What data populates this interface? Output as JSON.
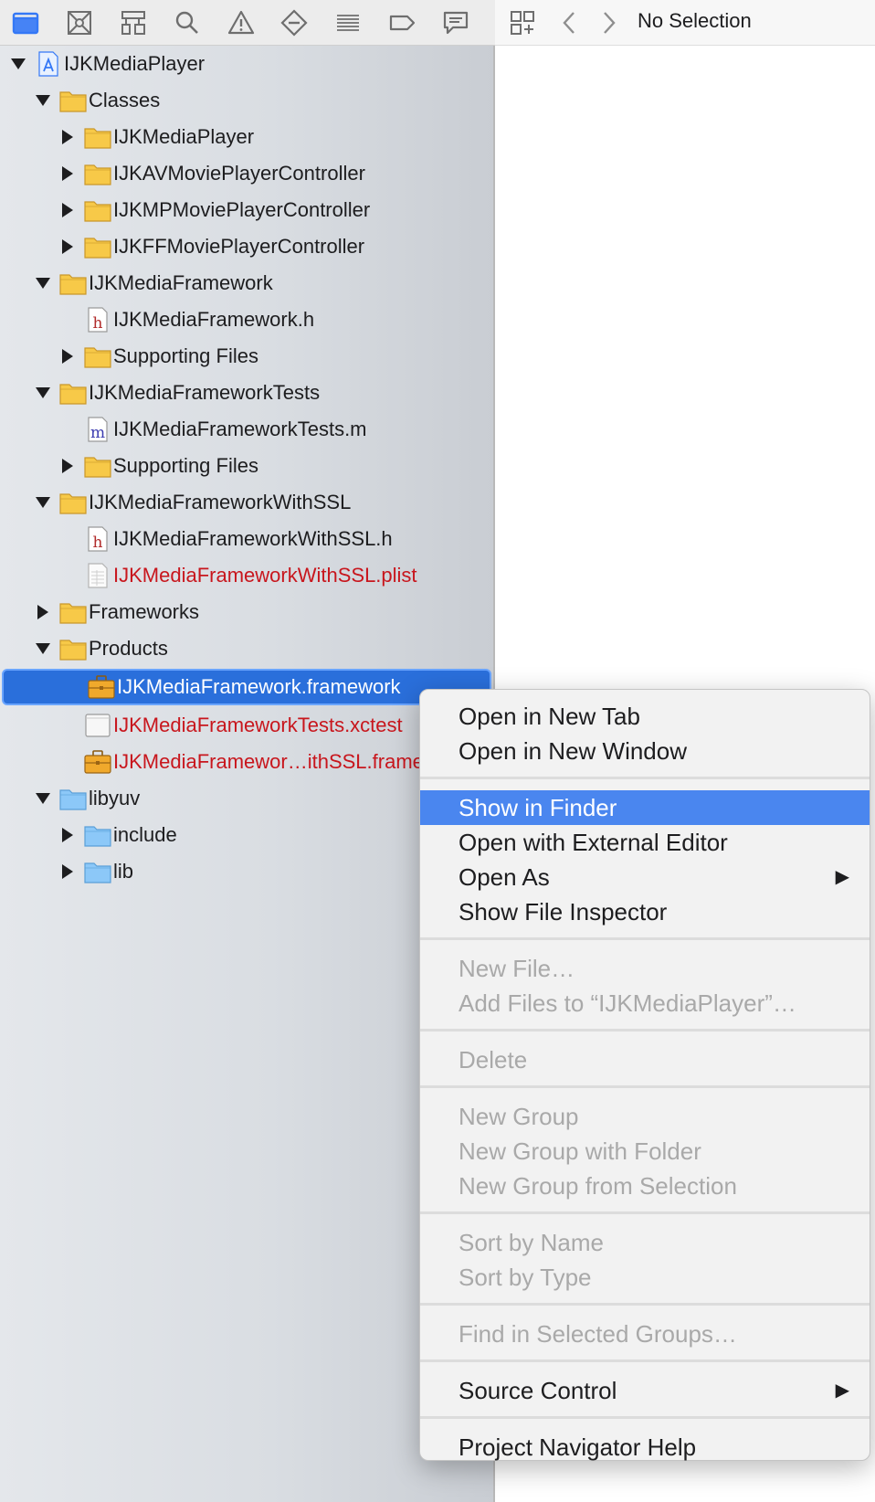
{
  "toolbar": {
    "icons": [
      "project-navigator-icon",
      "source-control-icon",
      "symbol-navigator-icon",
      "find-navigator-icon",
      "issue-navigator-icon",
      "test-navigator-icon",
      "debug-navigator-icon",
      "breakpoint-navigator-icon",
      "report-navigator-icon"
    ],
    "active_color": "#3478f6"
  },
  "jumpbar": {
    "title": "No Selection",
    "icons": [
      "related-items-icon",
      "back-chevron-icon",
      "forward-chevron-icon"
    ]
  },
  "tree": [
    {
      "label": "IJKMediaPlayer",
      "kind": "project",
      "depth": 0,
      "disclosure": "open"
    },
    {
      "label": "Classes",
      "kind": "folder",
      "depth": 1,
      "disclosure": "open"
    },
    {
      "label": "IJKMediaPlayer",
      "kind": "folder",
      "depth": 2,
      "disclosure": "closed"
    },
    {
      "label": "IJKAVMoviePlayerController",
      "kind": "folder",
      "depth": 2,
      "disclosure": "closed"
    },
    {
      "label": "IJKMPMoviePlayerController",
      "kind": "folder",
      "depth": 2,
      "disclosure": "closed"
    },
    {
      "label": "IJKFFMoviePlayerController",
      "kind": "folder",
      "depth": 2,
      "disclosure": "closed"
    },
    {
      "label": "IJKMediaFramework",
      "kind": "folder",
      "depth": 1,
      "disclosure": "open"
    },
    {
      "label": "IJKMediaFramework.h",
      "kind": "h",
      "depth": 2,
      "disclosure": "none"
    },
    {
      "label": "Supporting Files",
      "kind": "folder",
      "depth": 2,
      "disclosure": "closed"
    },
    {
      "label": "IJKMediaFrameworkTests",
      "kind": "folder",
      "depth": 1,
      "disclosure": "open"
    },
    {
      "label": "IJKMediaFrameworkTests.m",
      "kind": "m",
      "depth": 2,
      "disclosure": "none"
    },
    {
      "label": "Supporting Files",
      "kind": "folder",
      "depth": 2,
      "disclosure": "closed"
    },
    {
      "label": "IJKMediaFrameworkWithSSL",
      "kind": "folder",
      "depth": 1,
      "disclosure": "open"
    },
    {
      "label": "IJKMediaFrameworkWithSSL.h",
      "kind": "h",
      "depth": 2,
      "disclosure": "none"
    },
    {
      "label": "IJKMediaFrameworkWithSSL.plist",
      "kind": "plist",
      "depth": 2,
      "disclosure": "none",
      "missing": true
    },
    {
      "label": "Frameworks",
      "kind": "folder",
      "depth": 1,
      "disclosure": "closed"
    },
    {
      "label": "Products",
      "kind": "folder",
      "depth": 1,
      "disclosure": "open"
    },
    {
      "label": "IJKMediaFramework.framework",
      "kind": "framework",
      "depth": 2,
      "disclosure": "none",
      "selected": true
    },
    {
      "label": "IJKMediaFrameworkTests.xctest",
      "kind": "xctest",
      "depth": 2,
      "disclosure": "none",
      "missing": true
    },
    {
      "label": "IJKMediaFramewor…ithSSL.framework",
      "kind": "framework",
      "depth": 2,
      "disclosure": "none",
      "missing": true
    },
    {
      "label": "libyuv",
      "kind": "bluefolder",
      "depth": 1,
      "disclosure": "open"
    },
    {
      "label": "include",
      "kind": "bluefolder",
      "depth": 2,
      "disclosure": "closed"
    },
    {
      "label": "lib",
      "kind": "bluefolder",
      "depth": 2,
      "disclosure": "closed"
    }
  ],
  "context_menu": {
    "groups": [
      [
        {
          "label": "Open in New Tab"
        },
        {
          "label": "Open in New Window"
        }
      ],
      [
        {
          "label": "Show in Finder",
          "highlighted": true
        },
        {
          "label": "Open with External Editor"
        },
        {
          "label": "Open As",
          "submenu": true
        },
        {
          "label": "Show File Inspector"
        }
      ],
      [
        {
          "label": "New File…",
          "disabled": true
        },
        {
          "label": "Add Files to “IJKMediaPlayer”…",
          "disabled": true
        }
      ],
      [
        {
          "label": "Delete",
          "disabled": true
        }
      ],
      [
        {
          "label": "New Group",
          "disabled": true
        },
        {
          "label": "New Group with Folder",
          "disabled": true
        },
        {
          "label": "New Group from Selection",
          "disabled": true
        }
      ],
      [
        {
          "label": "Sort by Name",
          "disabled": true
        },
        {
          "label": "Sort by Type",
          "disabled": true
        }
      ],
      [
        {
          "label": "Find in Selected Groups…",
          "disabled": true
        }
      ],
      [
        {
          "label": "Source Control",
          "submenu": true
        }
      ],
      [
        {
          "label": "Project Navigator Help"
        }
      ]
    ],
    "highlight_color": "#4a86ef"
  }
}
